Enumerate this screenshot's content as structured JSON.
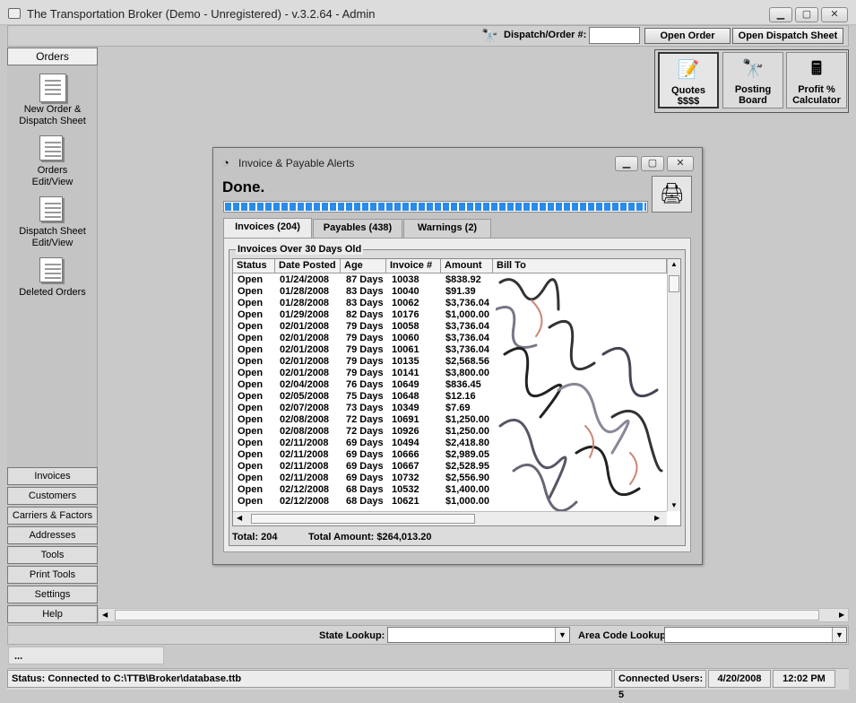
{
  "window": {
    "title": "The Transportation Broker (Demo - Unregistered) - v.3.2.64 - Admin",
    "min": "▁",
    "max": "▢",
    "close": "✕"
  },
  "toolbar": {
    "dispatch_label": "Dispatch/Order #:",
    "dispatch_value": "",
    "open_order": "Open Order",
    "open_dispatch": "Open Dispatch Sheet"
  },
  "sidebar": {
    "tab": "Orders",
    "items": [
      {
        "label": "New Order & Dispatch Sheet",
        "line1": "New Order &",
        "line2": "Dispatch Sheet"
      },
      {
        "label": "Orders Edit/View",
        "line1": "Orders",
        "line2": "Edit/View"
      },
      {
        "label": "Dispatch Sheet Edit/View",
        "line1": "Dispatch Sheet",
        "line2": "Edit/View"
      },
      {
        "label": "Deleted Orders",
        "line1": "Deleted Orders",
        "line2": ""
      }
    ],
    "bottom": [
      "Invoices",
      "Customers",
      "Carriers & Factors",
      "Addresses",
      "Tools",
      "Print Tools",
      "Settings",
      "Help"
    ]
  },
  "quick": [
    {
      "line1": "Quotes",
      "line2": "$$$$",
      "icon": "📝"
    },
    {
      "line1": "Posting",
      "line2": "Board",
      "icon": "🔭"
    },
    {
      "line1": "Profit %",
      "line2": "Calculator",
      "icon": "🖩"
    }
  ],
  "dialog": {
    "title": "Invoice & Payable Alerts",
    "done": "Done.",
    "progress": 1.0,
    "tabs": [
      "Invoices (204)",
      "Payables (438)",
      "Warnings (2)"
    ],
    "group_title": "Invoices Over 30 Days Old",
    "columns": [
      "Status",
      "Date Posted",
      "Age",
      "Invoice #",
      "Amount",
      "Bill To"
    ],
    "rows": [
      [
        "Open",
        "01/24/2008",
        "87 Days",
        "10038",
        "$838.92"
      ],
      [
        "Open",
        "01/28/2008",
        "83 Days",
        "10040",
        "$91.39"
      ],
      [
        "Open",
        "01/28/2008",
        "83 Days",
        "10062",
        "$3,736.04"
      ],
      [
        "Open",
        "01/29/2008",
        "82 Days",
        "10176",
        "$1,000.00"
      ],
      [
        "Open",
        "02/01/2008",
        "79 Days",
        "10058",
        "$3,736.04"
      ],
      [
        "Open",
        "02/01/2008",
        "79 Days",
        "10060",
        "$3,736.04"
      ],
      [
        "Open",
        "02/01/2008",
        "79 Days",
        "10061",
        "$3,736.04"
      ],
      [
        "Open",
        "02/01/2008",
        "79 Days",
        "10135",
        "$2,568.56"
      ],
      [
        "Open",
        "02/01/2008",
        "79 Days",
        "10141",
        "$3,800.00"
      ],
      [
        "Open",
        "02/04/2008",
        "76 Days",
        "10649",
        "$836.45"
      ],
      [
        "Open",
        "02/05/2008",
        "75 Days",
        "10648",
        "$12.16"
      ],
      [
        "Open",
        "02/07/2008",
        "73 Days",
        "10349",
        "$7.69"
      ],
      [
        "Open",
        "02/08/2008",
        "72 Days",
        "10691",
        "$1,250.00"
      ],
      [
        "Open",
        "02/08/2008",
        "72 Days",
        "10926",
        "$1,250.00"
      ],
      [
        "Open",
        "02/11/2008",
        "69 Days",
        "10494",
        "$2,418.80"
      ],
      [
        "Open",
        "02/11/2008",
        "69 Days",
        "10666",
        "$2,989.05"
      ],
      [
        "Open",
        "02/11/2008",
        "69 Days",
        "10667",
        "$2,528.95"
      ],
      [
        "Open",
        "02/11/2008",
        "69 Days",
        "10732",
        "$2,556.90"
      ],
      [
        "Open",
        "02/12/2008",
        "68 Days",
        "10532",
        "$1,400.00"
      ],
      [
        "Open",
        "02/12/2008",
        "68 Days",
        "10621",
        "$1,000.00"
      ]
    ],
    "total": "Total: 204",
    "total_amount": "Total Amount: $264,013.20"
  },
  "lookups": {
    "state_label": "State Lookup:",
    "area_label": "Area Code Lookup:"
  },
  "message": "...",
  "status": {
    "text": "Status: Connected to C:\\TTB\\Broker\\database.ttb",
    "users": "Connected Users: 5",
    "date": "4/20/2008",
    "time": "12:02 PM"
  },
  "colors": {
    "progress": "#2b8be8",
    "background": "#c9c9c9"
  }
}
